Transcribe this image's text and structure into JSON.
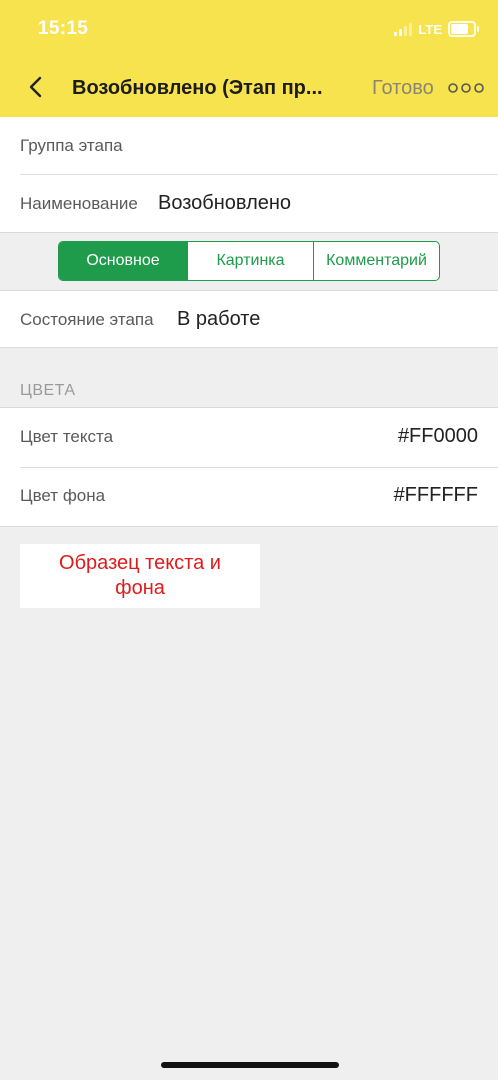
{
  "status_bar": {
    "time": "15:15",
    "network": "LTE"
  },
  "nav": {
    "title": "Возобновлено (Этап пр...",
    "done_label": "Готово",
    "back_icon": "chevron-left-icon",
    "more_icon": "more-dots-icon"
  },
  "form": {
    "group_label": "Группа этапа",
    "group_value": "",
    "name_label": "Наименование",
    "name_value": "Возобновлено"
  },
  "tabs": [
    {
      "label": "Основное",
      "active": true
    },
    {
      "label": "Картинка",
      "active": false
    },
    {
      "label": "Комментарий",
      "active": false
    }
  ],
  "state": {
    "label": "Состояние этапа",
    "value": "В работе"
  },
  "colors_section": {
    "header": "ЦВЕТА",
    "text_color_label": "Цвет текста",
    "text_color_value": "#FF0000",
    "bg_color_label": "Цвет фона",
    "bg_color_value": "#FFFFFF"
  },
  "sample": {
    "text": "Образец текста и фона",
    "text_color": "#FF0000",
    "background": "#FFFFFF"
  },
  "theme": {
    "header_bg": "#f7e34e",
    "accent": "#1e9b4b"
  }
}
